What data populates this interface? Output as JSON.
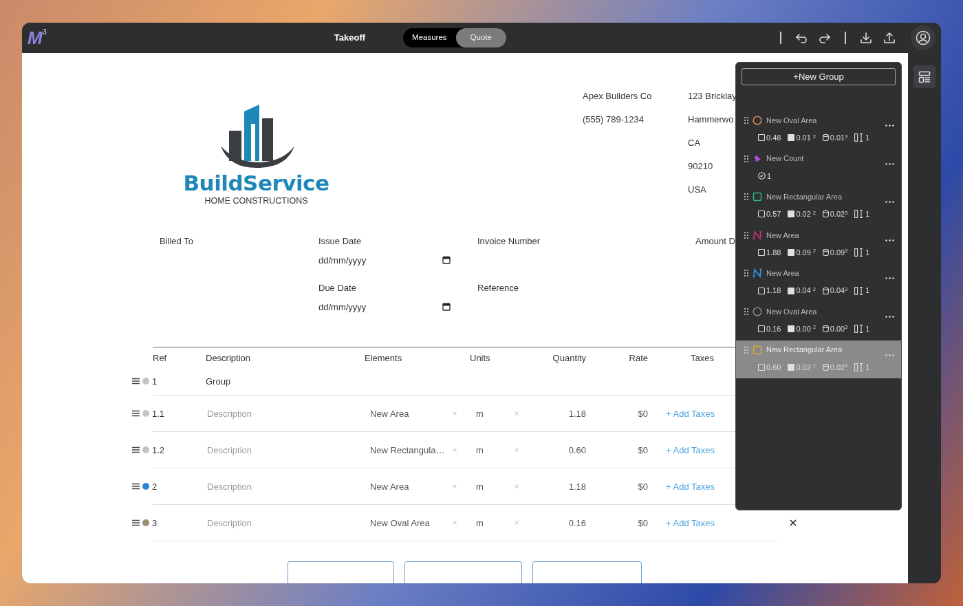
{
  "topbar": {
    "logo": "M$^{3}$",
    "title": "Takeoff",
    "modes": [
      {
        "label": "Measures",
        "selected": false
      },
      {
        "label": "Quote",
        "selected": true
      }
    ]
  },
  "document": {
    "logo": {
      "name": "BuildService",
      "tagline": "HOME CONSTRUCTIONS"
    },
    "company": [
      "Apex Builders Co",
      "(555) 789-1234"
    ],
    "address": [
      "123 Bricklay",
      "Hammerwo",
      "CA",
      "90210",
      "USA"
    ],
    "meta": [
      {
        "fields": [
          {
            "label": "Billed To"
          }
        ]
      },
      {
        "fields": [
          {
            "label": "Issue Date",
            "placeholder": "dd/mm/yyyy"
          },
          {
            "label": "Due Date",
            "placeholder": "dd/mm/yyyy"
          }
        ]
      },
      {
        "fields": [
          {
            "label": "Invoice Number"
          },
          {
            "label": "Reference"
          }
        ]
      },
      {
        "fields": [
          {
            "label": "Amount D"
          }
        ]
      }
    ],
    "table": {
      "columns": [
        "Ref",
        "Description",
        "Elements",
        "Units",
        "Quantity",
        "Rate",
        "Taxes"
      ],
      "rows": [
        {
          "kind": "group",
          "ref": "1",
          "color": "#c4c4c4",
          "description": "Group"
        },
        {
          "kind": "item",
          "ref": "1.1",
          "color": "#c4c4c4",
          "placeholder": "Description",
          "element": "New Area",
          "unit": "m",
          "quantity": "1.18",
          "rate": "$0",
          "taxes": "+ Add Taxes",
          "deletable": false
        },
        {
          "kind": "item",
          "ref": "1.2",
          "color": "#c4c4c4",
          "placeholder": "Description",
          "element": "New Rectangula…",
          "unit": "m",
          "quantity": "0.60",
          "rate": "$0",
          "taxes": "+ Add Taxes",
          "deletable": false
        },
        {
          "kind": "item",
          "ref": "2",
          "color": "#2a86dc",
          "placeholder": "Description",
          "element": "New Area",
          "unit": "m",
          "quantity": "1.18",
          "rate": "$0",
          "taxes": "+ Add Taxes",
          "deletable": false
        },
        {
          "kind": "item",
          "ref": "3",
          "color": "#9a8f74",
          "placeholder": "Description",
          "element": "New Oval Area",
          "unit": "m",
          "quantity": "0.16",
          "rate": "$0",
          "taxes": "+ Add Taxes",
          "deletable": true
        }
      ]
    }
  },
  "panel": {
    "button": "+New Group",
    "items": [
      {
        "name": "New Oval Area",
        "kind": "oval",
        "color": "#e08a4a",
        "selected": false,
        "stats": [
          {
            "kind": "perimeter",
            "value": "0.48"
          },
          {
            "kind": "area",
            "value": "0.01 $^{2}$"
          },
          {
            "kind": "volume",
            "value": "0.01$^{3}$"
          },
          {
            "kind": "count",
            "value": "1"
          }
        ]
      },
      {
        "name": "New Count",
        "kind": "count",
        "color": "#b04fd8",
        "selected": false,
        "stats": [
          {
            "kind": "tally",
            "value": "1"
          }
        ]
      },
      {
        "name": "New Rectangular Area",
        "kind": "rect",
        "color": "#2fb37a",
        "selected": false,
        "stats": [
          {
            "kind": "perimeter",
            "value": "0.57"
          },
          {
            "kind": "area",
            "value": "0.02 $^{2}$"
          },
          {
            "kind": "volume",
            "value": "0.02$^{3}$"
          },
          {
            "kind": "count",
            "value": "1"
          }
        ]
      },
      {
        "name": "New Area",
        "kind": "polygon",
        "color": "#c0306a",
        "selected": false,
        "stats": [
          {
            "kind": "perimeter",
            "value": "1.88"
          },
          {
            "kind": "area",
            "value": "0.09 $^{2}$"
          },
          {
            "kind": "volume",
            "value": "0.09$^{3}$"
          },
          {
            "kind": "count",
            "value": "1"
          }
        ]
      },
      {
        "name": "New Area",
        "kind": "polygon",
        "color": "#3a8fd8",
        "selected": false,
        "stats": [
          {
            "kind": "perimeter",
            "value": "1.18"
          },
          {
            "kind": "area",
            "value": "0.04 $^{2}$"
          },
          {
            "kind": "volume",
            "value": "0.04$^{3}$"
          },
          {
            "kind": "count",
            "value": "1"
          }
        ]
      },
      {
        "name": "New Oval Area",
        "kind": "oval",
        "color": "#8a8a7a",
        "selected": false,
        "stats": [
          {
            "kind": "perimeter",
            "value": "0.16"
          },
          {
            "kind": "area",
            "value": "0.00 $^{2}$"
          },
          {
            "kind": "volume",
            "value": "0.00$^{3}$"
          },
          {
            "kind": "count",
            "value": "1"
          }
        ]
      },
      {
        "name": "New Rectangular Area",
        "kind": "rect",
        "color": "#e0a830",
        "selected": true,
        "stats": [
          {
            "kind": "perimeter",
            "value": "0.60"
          },
          {
            "kind": "area",
            "value": "0.02 $^{2}$"
          },
          {
            "kind": "volume",
            "value": "0.02$^{3}$"
          },
          {
            "kind": "count",
            "value": "1"
          }
        ]
      }
    ]
  }
}
